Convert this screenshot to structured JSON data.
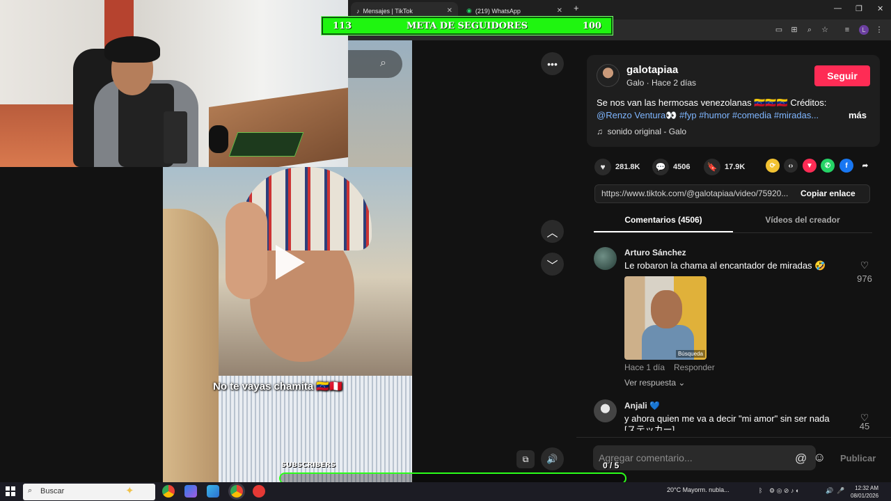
{
  "browser": {
    "tabs": [
      {
        "label": "Mensajes | TikTok",
        "active": true
      },
      {
        "label": "(219) WhatsApp",
        "active": false
      }
    ],
    "new_tab": "+",
    "window": {
      "minimize": "—",
      "restore": "❐",
      "close": "✕"
    }
  },
  "overlay": {
    "goal_left": "113",
    "goal_title": "META DE SEGUIDORES",
    "goal_right": "100",
    "subs_label": "SUBSCRIBERS",
    "subs_count": "0 / 5"
  },
  "video": {
    "caption": "No te vayas chamita 🇻🇪🇵🇪"
  },
  "post": {
    "username": "galotapiaa",
    "subline": "Galo · Hace 2 días",
    "follow_label": "Seguir",
    "desc_line1": "Se nos van las hermosas venezolanas 🇻🇪🇻🇪🇻🇪 Créditos:",
    "desc_mention": "@Renzo Ventura👀",
    "desc_tags": "#fyp #humor #comedia #miradas...",
    "more_label": "más",
    "sound": "sonido original - Galo",
    "likes": "281.8K",
    "comments_count": "4506",
    "saves": "17.9K",
    "url": "https://www.tiktok.com/@galotapiaa/video/75920...",
    "copy_label": "Copiar enlace"
  },
  "tabs": {
    "comments": "Comentarios (4506)",
    "videos": "Vídeos del creador"
  },
  "comments": [
    {
      "name": "Arturo Sánchez",
      "text": "Le robaron la chama al encantador de miradas 🤣",
      "sticker_tag": "Búsqueda",
      "time": "Hace 1 día",
      "reply": "Responder",
      "replies": "Ver respuesta ⌄",
      "likes": "976"
    },
    {
      "name": "Anjali 💙",
      "text": "y ahora quien me va a decir \"mi amor\" sin ser nada",
      "text2": "[ステッカー]",
      "likes": "45"
    }
  ],
  "composer": {
    "placeholder": "Agregar comentario...",
    "publish": "Publicar"
  },
  "taskbar": {
    "search": "Buscar",
    "weather": "20°C  Mayorm. nubla...",
    "time": "12:32 AM",
    "date": "08/01/2026"
  },
  "colors": {
    "accent": "#fe2c55",
    "goal_green": "#1ff510",
    "link": "#7fb6ff"
  }
}
